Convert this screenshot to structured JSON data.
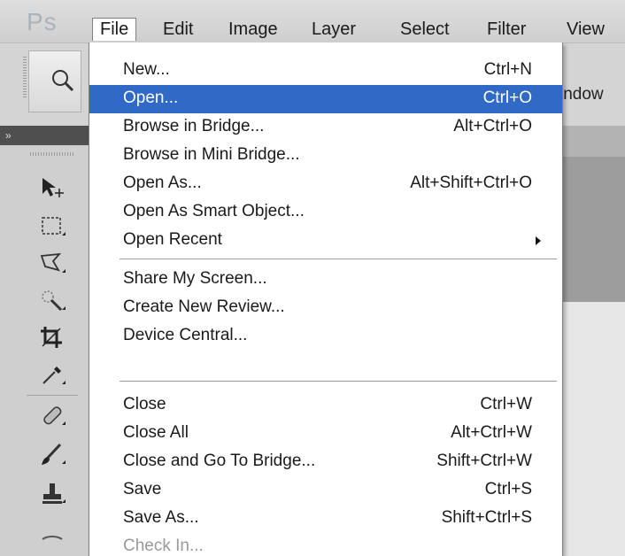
{
  "app": {
    "logo": "Ps"
  },
  "menubar": {
    "items": [
      "File",
      "Edit",
      "Image",
      "Layer",
      "Select",
      "Filter",
      "View"
    ],
    "active": "File"
  },
  "optionsbar": {
    "truncated_label": "indow"
  },
  "tools": {
    "header": "»",
    "items": [
      {
        "icon": "move-tool-icon"
      },
      {
        "icon": "rectangular-marquee-icon"
      },
      {
        "icon": "lasso-icon"
      },
      {
        "icon": "quick-selection-icon"
      },
      {
        "icon": "crop-icon"
      },
      {
        "icon": "eyedropper-icon"
      },
      {
        "icon": "spot-healing-brush-icon"
      },
      {
        "icon": "brush-icon"
      },
      {
        "icon": "clone-stamp-icon"
      }
    ]
  },
  "file_menu": {
    "groups": [
      [
        {
          "label": "New...",
          "shortcut": "Ctrl+N"
        },
        {
          "label": "Open...",
          "shortcut": "Ctrl+O",
          "highlighted": true
        },
        {
          "label": "Browse in Bridge...",
          "shortcut": "Alt+Ctrl+O"
        },
        {
          "label": "Browse in Mini Bridge...",
          "shortcut": ""
        },
        {
          "label": "Open As...",
          "shortcut": "Alt+Shift+Ctrl+O"
        },
        {
          "label": "Open As Smart Object...",
          "shortcut": ""
        },
        {
          "label": "Open Recent",
          "shortcut": "",
          "submenu": true
        }
      ],
      [
        {
          "label": "Share My Screen...",
          "shortcut": ""
        },
        {
          "label": "Create New Review...",
          "shortcut": ""
        },
        {
          "label": "Device Central...",
          "shortcut": ""
        }
      ],
      [
        {
          "label": "Close",
          "shortcut": "Ctrl+W"
        },
        {
          "label": "Close All",
          "shortcut": "Alt+Ctrl+W"
        },
        {
          "label": "Close and Go To Bridge...",
          "shortcut": "Shift+Ctrl+W"
        },
        {
          "label": "Save",
          "shortcut": "Ctrl+S"
        },
        {
          "label": "Save As...",
          "shortcut": "Shift+Ctrl+S"
        },
        {
          "label": "Check In...",
          "shortcut": "",
          "disabled": true
        }
      ]
    ]
  },
  "colors": {
    "highlight": "#3169c6",
    "menu_bg": "#ffffff",
    "panel": "#cfcfcf"
  }
}
